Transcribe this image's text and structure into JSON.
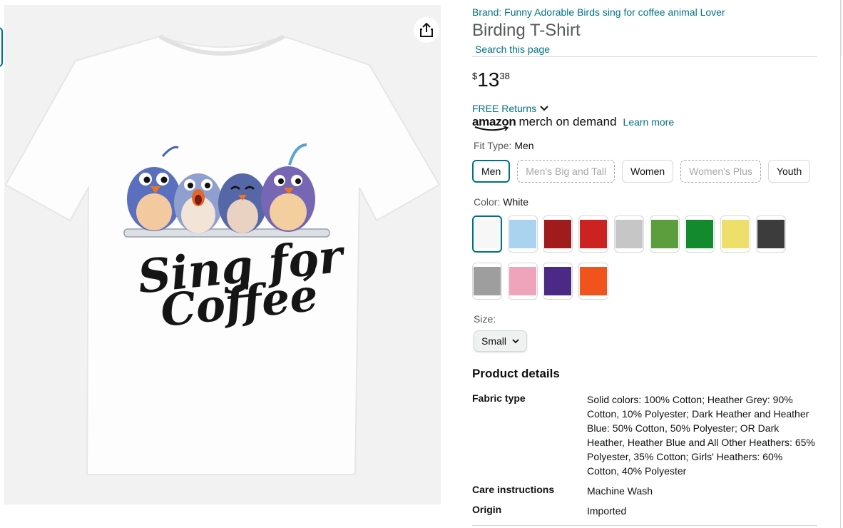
{
  "product": {
    "brand_link": "Brand: Funny Adorable Birds sing for coffee animal Lover",
    "title": "Birding T-Shirt",
    "search_link": "Search this page",
    "price": {
      "symbol": "$",
      "whole": "13",
      "fraction": "38"
    },
    "returns": "FREE Returns",
    "merch": {
      "amazon": "amazon",
      "text": "merch on demand",
      "learn_more": "Learn more"
    },
    "shirt_graphic_text": {
      "line1": "Sing for",
      "line2": "Coffee"
    }
  },
  "fit_type": {
    "label": "Fit Type: ",
    "value": "Men",
    "options": [
      {
        "label": "Men",
        "state": "selected"
      },
      {
        "label": "Men's Big and Tall",
        "state": "unavailable"
      },
      {
        "label": "Women",
        "state": "available"
      },
      {
        "label": "Women's Plus",
        "state": "unavailable"
      },
      {
        "label": "Youth",
        "state": "available"
      }
    ]
  },
  "color": {
    "label": "Color: ",
    "value": "White",
    "swatches": [
      {
        "hex": "#f7f7f7",
        "selected": true
      },
      {
        "hex": "#a9d3ee",
        "selected": false
      },
      {
        "hex": "#a01b1b",
        "selected": false
      },
      {
        "hex": "#cc2222",
        "selected": false
      },
      {
        "hex": "#c6c6c6",
        "selected": false
      },
      {
        "hex": "#5c9e3e",
        "selected": false
      },
      {
        "hex": "#148a2e",
        "selected": false
      },
      {
        "hex": "#eedf6a",
        "selected": false
      },
      {
        "hex": "#3c3c3c",
        "selected": false
      },
      {
        "hex": "#9e9e9e",
        "selected": false
      },
      {
        "hex": "#f0a4bc",
        "selected": false
      },
      {
        "hex": "#4a2a85",
        "selected": false
      },
      {
        "hex": "#f0541c",
        "selected": false
      }
    ]
  },
  "size": {
    "label": "Size:",
    "selected": "Small"
  },
  "product_details": {
    "heading": "Product details",
    "rows": [
      {
        "key": "Fabric type",
        "value": "Solid colors: 100% Cotton; Heather Grey: 90% Cotton, 10% Polyester; Dark Heather and Heather Blue: 50% Cotton, 50% Polyester; OR Dark Heather, Heather Blue and All Other Heathers: 65% Polyester, 35% Cotton; Girls' Heathers: 60% Cotton, 40% Polyester"
      },
      {
        "key": "Care instructions",
        "value": "Machine Wash"
      },
      {
        "key": "Origin",
        "value": "Imported"
      }
    ]
  },
  "colors": {
    "link": "#007185",
    "text": "#0f1111",
    "muted": "#565959",
    "selected_border": "#007185"
  }
}
